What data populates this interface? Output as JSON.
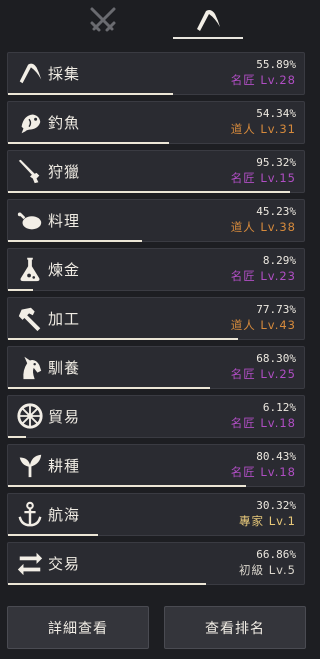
{
  "tabs": [
    {
      "name": "combat",
      "icon": "crossed-swords-icon",
      "active": false
    },
    {
      "name": "life",
      "icon": "sickle-icon",
      "active": true
    }
  ],
  "skills": [
    {
      "name": "採集",
      "icon": "sickle-icon",
      "percent": "55.89%",
      "rank": "名匠 Lv.28",
      "rank_color": "#b04ec4",
      "progress": 0.5589
    },
    {
      "name": "釣魚",
      "icon": "fish-icon",
      "percent": "54.34%",
      "rank": "道人 Lv.31",
      "rank_color": "#d68a3c",
      "progress": 0.5434
    },
    {
      "name": "狩獵",
      "icon": "rifle-icon",
      "percent": "95.32%",
      "rank": "名匠 Lv.15",
      "rank_color": "#b04ec4",
      "progress": 0.9532
    },
    {
      "name": "料理",
      "icon": "roast-chicken-icon",
      "percent": "45.23%",
      "rank": "道人 Lv.38",
      "rank_color": "#d68a3c",
      "progress": 0.4523
    },
    {
      "name": "煉金",
      "icon": "flask-icon",
      "percent": "8.29%",
      "rank": "名匠 Lv.23",
      "rank_color": "#b04ec4",
      "progress": 0.0829
    },
    {
      "name": "加工",
      "icon": "hammer-icon",
      "percent": "77.73%",
      "rank": "道人 Lv.43",
      "rank_color": "#d68a3c",
      "progress": 0.7773
    },
    {
      "name": "馴養",
      "icon": "horse-head-icon",
      "percent": "68.30%",
      "rank": "名匠 Lv.25",
      "rank_color": "#b04ec4",
      "progress": 0.683
    },
    {
      "name": "貿易",
      "icon": "wheel-icon",
      "percent": "6.12%",
      "rank": "名匠 Lv.18",
      "rank_color": "#b04ec4",
      "progress": 0.0612
    },
    {
      "name": "耕種",
      "icon": "sprout-icon",
      "percent": "80.43%",
      "rank": "名匠 Lv.18",
      "rank_color": "#b04ec4",
      "progress": 0.8043
    },
    {
      "name": "航海",
      "icon": "anchor-icon",
      "percent": "30.32%",
      "rank": "專家 Lv.1",
      "rank_color": "#e8c97a",
      "progress": 0.3032
    },
    {
      "name": "交易",
      "icon": "exchange-arrows-icon",
      "percent": "66.86%",
      "rank": "初級 Lv.5",
      "rank_color": "#d9d5cc",
      "progress": 0.6686
    }
  ],
  "buttons": {
    "detail": "詳細查看",
    "ranking": "查看排名"
  },
  "colors": {
    "background": "#1d1e22",
    "row": "#2a2b31",
    "bar": "#ece6d6",
    "icon": "#f2eee6",
    "tab_inactive": "#6a6b70"
  }
}
